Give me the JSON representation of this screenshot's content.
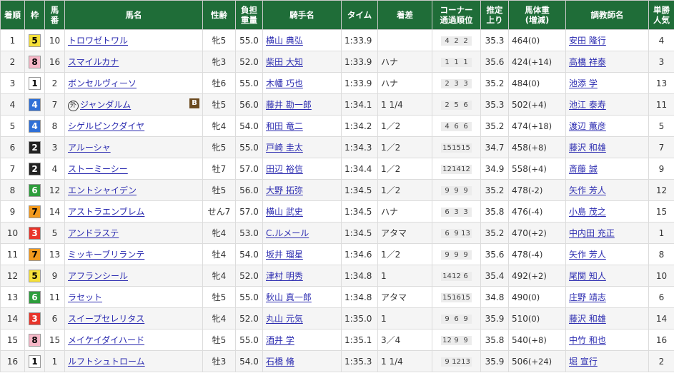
{
  "headers": {
    "rank": "着順",
    "waku": "枠",
    "umaban": [
      "馬",
      "番"
    ],
    "horse": "馬名",
    "sexage": "性齢",
    "weight": [
      "負担",
      "重量"
    ],
    "jockey": "騎手名",
    "time": "タイム",
    "margin": "着差",
    "corner": [
      "コーナー",
      "通過順位"
    ],
    "last3f": [
      "推定",
      "上り"
    ],
    "bodyweight": [
      "馬体重",
      "(増減)"
    ],
    "trainer": "調教師名",
    "pop": [
      "単勝",
      "人気"
    ]
  },
  "waku_colors": {
    "1": {
      "bg": "#ffffff",
      "fg": "#000000"
    },
    "2": {
      "bg": "#222222",
      "fg": "#ffffff"
    },
    "3": {
      "bg": "#e8352b",
      "fg": "#ffffff"
    },
    "4": {
      "bg": "#2f6fd6",
      "fg": "#ffffff"
    },
    "5": {
      "bg": "#f5e03a",
      "fg": "#000000"
    },
    "6": {
      "bg": "#2e9d3c",
      "fg": "#ffffff"
    },
    "7": {
      "bg": "#f39a1e",
      "fg": "#000000"
    },
    "8": {
      "bg": "#f7b8c8",
      "fg": "#000000"
    }
  },
  "rows": [
    {
      "rank": "1",
      "waku": "5",
      "umaban": "10",
      "horse": "トロワゼトワル",
      "foreign": "",
      "blinker": "",
      "sexage": "牝5",
      "weight": "55.0",
      "jockey": "横山 典弘",
      "time": "1:33.9",
      "margin": "",
      "corner": [
        "4",
        "2",
        "2"
      ],
      "last3f": "35.3",
      "bw": "464",
      "bwchg": "(0)",
      "trainer": "安田 隆行",
      "pop": "4"
    },
    {
      "rank": "2",
      "waku": "8",
      "umaban": "16",
      "horse": "スマイルカナ",
      "foreign": "",
      "blinker": "",
      "sexage": "牝3",
      "weight": "52.0",
      "jockey": "柴田 大知",
      "time": "1:33.9",
      "margin": "ハナ",
      "corner": [
        "1",
        "1",
        "1"
      ],
      "last3f": "35.6",
      "bw": "424",
      "bwchg": "(+14)",
      "trainer": "高橋 祥泰",
      "pop": "3"
    },
    {
      "rank": "3",
      "waku": "1",
      "umaban": "2",
      "horse": "ボンセルヴィーソ",
      "foreign": "",
      "blinker": "",
      "sexage": "牡6",
      "weight": "55.0",
      "jockey": "木幡 巧也",
      "time": "1:33.9",
      "margin": "ハナ",
      "corner": [
        "2",
        "3",
        "3"
      ],
      "last3f": "35.2",
      "bw": "484",
      "bwchg": "(0)",
      "trainer": "池添 学",
      "pop": "13"
    },
    {
      "rank": "4",
      "waku": "4",
      "umaban": "7",
      "horse": "ジャンダルム",
      "foreign": "外",
      "blinker": "B",
      "sexage": "牡5",
      "weight": "56.0",
      "jockey": "藤井 勘一郎",
      "time": "1:34.1",
      "margin": "1 1/4",
      "corner": [
        "2",
        "5",
        "6"
      ],
      "last3f": "35.3",
      "bw": "502",
      "bwchg": "(+4)",
      "trainer": "池江 泰寿",
      "pop": "11"
    },
    {
      "rank": "5",
      "waku": "4",
      "umaban": "8",
      "horse": "シゲルピンクダイヤ",
      "foreign": "",
      "blinker": "",
      "sexage": "牝4",
      "weight": "54.0",
      "jockey": "和田 竜二",
      "time": "1:34.2",
      "margin": "1／2",
      "corner": [
        "4",
        "6",
        "6"
      ],
      "last3f": "35.2",
      "bw": "474",
      "bwchg": "(+18)",
      "trainer": "渡辺 薫彦",
      "pop": "5"
    },
    {
      "rank": "6",
      "waku": "2",
      "umaban": "3",
      "horse": "アルーシャ",
      "foreign": "",
      "blinker": "",
      "sexage": "牝5",
      "weight": "55.0",
      "jockey": "戸崎 圭太",
      "time": "1:34.3",
      "margin": "1／2",
      "corner": [
        "15",
        "15",
        "15"
      ],
      "last3f": "34.7",
      "bw": "458",
      "bwchg": "(+8)",
      "trainer": "藤沢 和雄",
      "pop": "7"
    },
    {
      "rank": "7",
      "waku": "2",
      "umaban": "4",
      "horse": "ストーミーシー",
      "foreign": "",
      "blinker": "",
      "sexage": "牡7",
      "weight": "57.0",
      "jockey": "田辺 裕信",
      "time": "1:34.4",
      "margin": "1／2",
      "corner": [
        "12",
        "14",
        "12"
      ],
      "last3f": "34.9",
      "bw": "558",
      "bwchg": "(+4)",
      "trainer": "斎藤 誠",
      "pop": "9"
    },
    {
      "rank": "8",
      "waku": "6",
      "umaban": "12",
      "horse": "エントシャイデン",
      "foreign": "",
      "blinker": "",
      "sexage": "牡5",
      "weight": "56.0",
      "jockey": "大野 拓弥",
      "time": "1:34.5",
      "margin": "1／2",
      "corner": [
        "9",
        "9",
        "9"
      ],
      "last3f": "35.2",
      "bw": "478",
      "bwchg": "(-2)",
      "trainer": "矢作 芳人",
      "pop": "12"
    },
    {
      "rank": "9",
      "waku": "7",
      "umaban": "14",
      "horse": "アストラエンブレム",
      "foreign": "",
      "blinker": "",
      "sexage": "せん7",
      "weight": "57.0",
      "jockey": "横山 武史",
      "time": "1:34.5",
      "margin": "ハナ",
      "corner": [
        "6",
        "3",
        "3"
      ],
      "last3f": "35.8",
      "bw": "476",
      "bwchg": "(-4)",
      "trainer": "小島 茂之",
      "pop": "15"
    },
    {
      "rank": "10",
      "waku": "3",
      "umaban": "5",
      "horse": "アンドラステ",
      "foreign": "",
      "blinker": "",
      "sexage": "牝4",
      "weight": "53.0",
      "jockey": "C.ルメール",
      "time": "1:34.5",
      "margin": "アタマ",
      "corner": [
        "6",
        "9",
        "13"
      ],
      "last3f": "35.2",
      "bw": "470",
      "bwchg": "(+2)",
      "trainer": "中内田 充正",
      "pop": "1"
    },
    {
      "rank": "11",
      "waku": "7",
      "umaban": "13",
      "horse": "ミッキーブリランテ",
      "foreign": "",
      "blinker": "",
      "sexage": "牡4",
      "weight": "54.0",
      "jockey": "坂井 瑠星",
      "time": "1:34.6",
      "margin": "1／2",
      "corner": [
        "9",
        "9",
        "9"
      ],
      "last3f": "35.6",
      "bw": "478",
      "bwchg": "(-4)",
      "trainer": "矢作 芳人",
      "pop": "8"
    },
    {
      "rank": "12",
      "waku": "5",
      "umaban": "9",
      "horse": "アフランシール",
      "foreign": "",
      "blinker": "",
      "sexage": "牝4",
      "weight": "52.0",
      "jockey": "津村 明秀",
      "time": "1:34.8",
      "margin": "1",
      "corner": [
        "14",
        "12",
        "6"
      ],
      "last3f": "35.4",
      "bw": "492",
      "bwchg": "(+2)",
      "trainer": "尾関 知人",
      "pop": "10"
    },
    {
      "rank": "13",
      "waku": "6",
      "umaban": "11",
      "horse": "ラセット",
      "foreign": "",
      "blinker": "",
      "sexage": "牡5",
      "weight": "55.0",
      "jockey": "秋山 真一郎",
      "time": "1:34.8",
      "margin": "アタマ",
      "corner": [
        "15",
        "16",
        "15"
      ],
      "last3f": "34.8",
      "bw": "490",
      "bwchg": "(0)",
      "trainer": "庄野 靖志",
      "pop": "6"
    },
    {
      "rank": "14",
      "waku": "3",
      "umaban": "6",
      "horse": "スイープセレリタス",
      "foreign": "",
      "blinker": "",
      "sexage": "牝4",
      "weight": "52.0",
      "jockey": "丸山 元気",
      "time": "1:35.0",
      "margin": "1",
      "corner": [
        "9",
        "6",
        "9"
      ],
      "last3f": "35.9",
      "bw": "510",
      "bwchg": "(0)",
      "trainer": "藤沢 和雄",
      "pop": "14"
    },
    {
      "rank": "15",
      "waku": "8",
      "umaban": "15",
      "horse": "メイケイダイハード",
      "foreign": "",
      "blinker": "",
      "sexage": "牡5",
      "weight": "55.0",
      "jockey": "酒井 学",
      "time": "1:35.1",
      "margin": "3／4",
      "corner": [
        "12",
        "9",
        "9"
      ],
      "last3f": "35.8",
      "bw": "540",
      "bwchg": "(+8)",
      "trainer": "中竹 和也",
      "pop": "16"
    },
    {
      "rank": "16",
      "waku": "1",
      "umaban": "1",
      "horse": "ルフトシュトローム",
      "foreign": "",
      "blinker": "",
      "sexage": "牡3",
      "weight": "54.0",
      "jockey": "石橋 脩",
      "time": "1:35.3",
      "margin": "1 1/4",
      "corner": [
        "9",
        "12",
        "13"
      ],
      "last3f": "35.9",
      "bw": "506",
      "bwchg": "(+24)",
      "trainer": "堀 宣行",
      "pop": "2"
    }
  ]
}
